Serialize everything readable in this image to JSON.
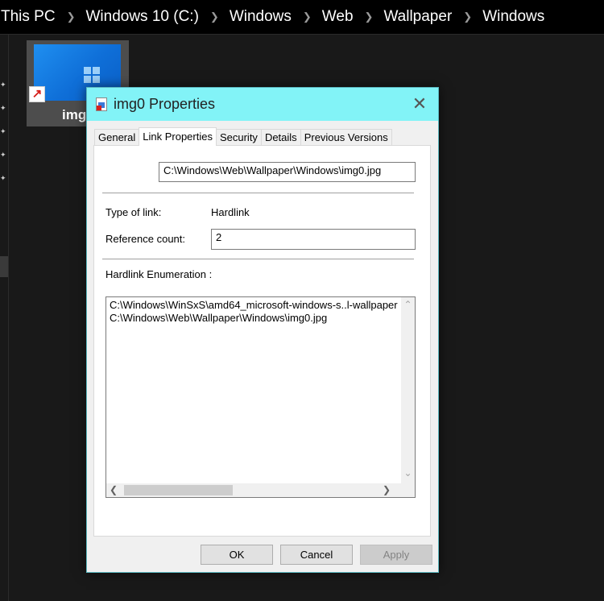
{
  "breadcrumb": [
    "This PC",
    "Windows 10 (C:)",
    "Windows",
    "Web",
    "Wallpaper",
    "Windows"
  ],
  "file_tile": {
    "label": "img0"
  },
  "dialog": {
    "title": "img0 Properties",
    "tabs": [
      "General",
      "Link Properties",
      "Security",
      "Details",
      "Previous Versions"
    ],
    "active_tab": "Link Properties",
    "target_path": "C:\\Windows\\Web\\Wallpaper\\Windows\\img0.jpg",
    "type_of_link_label": "Type of link:",
    "type_of_link_value": "Hardlink",
    "reference_count_label": "Reference count:",
    "reference_count_value": "2",
    "enumeration_label": "Hardlink Enumeration :",
    "enumeration_items": [
      "C:\\Windows\\WinSxS\\amd64_microsoft-windows-s..l-wallpaper",
      "C:\\Windows\\Web\\Wallpaper\\Windows\\img0.jpg"
    ],
    "buttons": {
      "ok": "OK",
      "cancel": "Cancel",
      "apply": "Apply"
    }
  },
  "colors": {
    "title_bar": "#82f3f7",
    "explorer_bg": "#191919",
    "accent_border": "#5bb8c0"
  },
  "icons": {
    "close": "close-icon",
    "chevron": "chevron-right-icon",
    "pin": "pin-icon",
    "shortcut": "shortcut-arrow-icon"
  }
}
